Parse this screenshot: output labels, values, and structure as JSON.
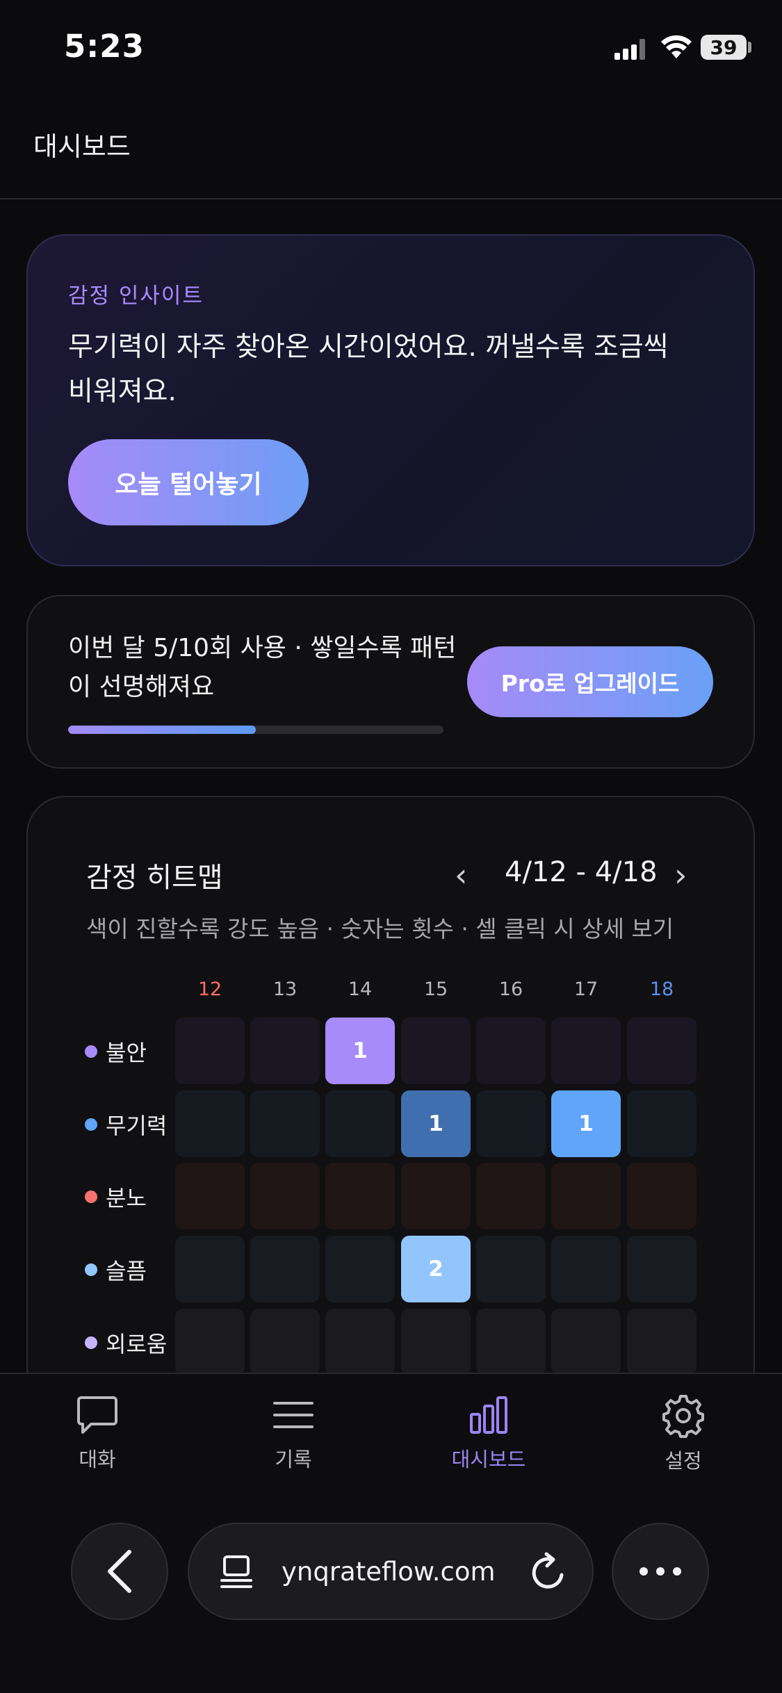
{
  "status_bar": {
    "time": "5:23",
    "battery": "39"
  },
  "header": {
    "title": "대시보드"
  },
  "insight": {
    "label": "감정 인사이트",
    "text": "무기력이 자주 찾아온 시간이었어요. 꺼낼수록 조금씩 비워져요.",
    "button": "오늘 털어놓기"
  },
  "usage": {
    "text": "이번 달 5/10회 사용 · 쌓일수록 패턴이 선명해져요",
    "progress": 0.5,
    "upgrade_button": "Pro로 업그레이드"
  },
  "heatmap": {
    "title": "감정 히트맵",
    "range": "4/12 - 4/18",
    "prev": "‹",
    "next": "›",
    "description": "색이 진할수록 강도 높음 · 숫자는 횟수 · 셀 클릭 시 상세 보기",
    "days": [
      "12",
      "13",
      "14",
      "15",
      "16",
      "17",
      "18"
    ],
    "day_colors": [
      "#ff6b6b",
      "#b7b7bd",
      "#b7b7bd",
      "#b7b7bd",
      "#b7b7bd",
      "#b7b7bd",
      "#5b8ff0"
    ],
    "rows": [
      {
        "label": "불안",
        "color": "#a78bfa",
        "base": "#1a1722",
        "counts": [
          0,
          0,
          1,
          0,
          0,
          0,
          0
        ],
        "cell_colors": [
          "",
          "",
          "#a78bfa",
          "",
          "",
          "",
          ""
        ]
      },
      {
        "label": "무기력",
        "color": "#60a5fa",
        "base": "#161a21",
        "counts": [
          0,
          0,
          0,
          1,
          0,
          1,
          0
        ],
        "cell_colors": [
          "",
          "",
          "",
          "#3f6fae",
          "",
          "#60a5fa",
          ""
        ]
      },
      {
        "label": "분노",
        "color": "#f87171",
        "base": "#201616",
        "counts": [
          0,
          0,
          0,
          0,
          0,
          0,
          0
        ],
        "cell_colors": [
          "",
          "",
          "",
          "",
          "",
          "",
          ""
        ]
      },
      {
        "label": "슬픔",
        "color": "#93c5fd",
        "base": "#181b20",
        "counts": [
          0,
          0,
          0,
          2,
          0,
          0,
          0
        ],
        "cell_colors": [
          "",
          "",
          "",
          "#93c5fd",
          "",
          "",
          ""
        ]
      },
      {
        "label": "외로움",
        "color": "#c4b5fd",
        "base": "#1b1b1e",
        "counts": [
          0,
          0,
          0,
          0,
          0,
          0,
          0
        ],
        "cell_colors": [
          "",
          "",
          "",
          "",
          "",
          "",
          ""
        ]
      }
    ]
  },
  "bottom_nav": {
    "tabs": [
      {
        "label": "대화",
        "icon": "chat-bubble-icon"
      },
      {
        "label": "기록",
        "icon": "list-icon"
      },
      {
        "label": "대시보드",
        "icon": "bar-chart-icon",
        "active": true
      },
      {
        "label": "설정",
        "icon": "gear-icon"
      }
    ]
  },
  "browser": {
    "url": "ynqrateflow.com"
  }
}
